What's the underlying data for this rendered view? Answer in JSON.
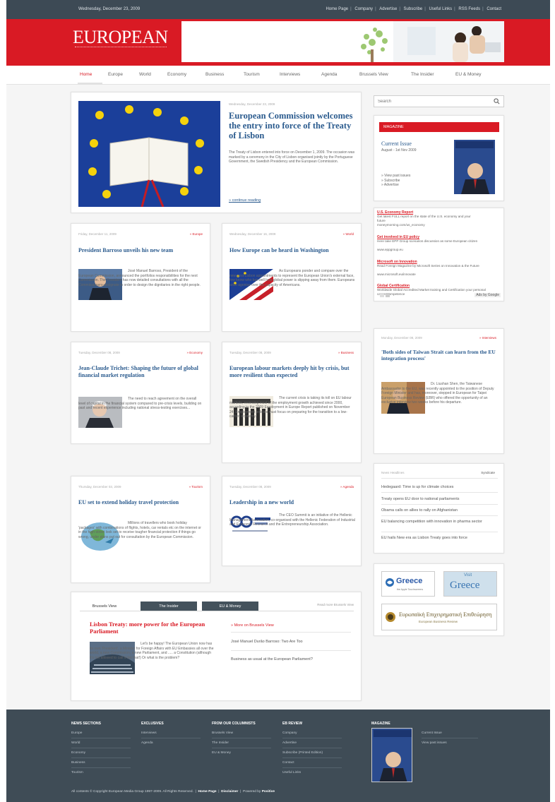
{
  "topbar": {
    "date": "Wednesday, December 23, 2009",
    "links": [
      "Home Page",
      "Company",
      "Advertise",
      "Subscribe",
      "Useful Links",
      "RSS Feeds",
      "Contact"
    ]
  },
  "brand": {
    "name": "EUROPEAN"
  },
  "nav": {
    "items": [
      "Home",
      "Europe",
      "World",
      "Economy",
      "Business",
      "Tourism",
      "Interviews",
      "Agenda",
      "Brussels View",
      "The Insider",
      "EU & Money"
    ]
  },
  "featured": {
    "date": "Wednesday, December 23, 2009",
    "title": "European Commission welcomes the entry into force of the Treaty of Lisbon",
    "summary": "The Treaty of Lisbon entered into force on December 1, 2009. The occasion was marked by a ceremony in the City of Lisbon organised jointly by the Portuguese Government, the Swedish Presidency and the European Commission.",
    "more": "continue reading"
  },
  "articles": [
    {
      "date": "Friday, December 11, 2009",
      "category": "Europe",
      "title": "President Barroso unveils his new team",
      "text": "José Manuel Barroso, President of the European Commission, announced the portfolios responsibilities for the next Commission. The President has now detailed consultations with all the Commissioners-designate in order to design the dignitaries in the right people."
    },
    {
      "date": "Wednesday, December 16, 2009",
      "category": "World",
      "title": "How Europe can be heard in Washington",
      "text": "As Europeans ponder and compare over the new post-Lisbon appointments to represent the European Union's external face, few know who but well how global power is slipping away from them. Europeans arise agonise over the capacity of Americans."
    },
    {
      "date": "Tuesday, December 08, 2009",
      "category": "Economy",
      "title": "Jean-Claude Trichet: Shaping the future of global financial market regulation",
      "text": "The need to reach agreement on the overall level of capital in the financial system compared to pre-crisis levels, building on past and recent experience including national stress-testing exercises..."
    },
    {
      "date": "Tuesday, December 08, 2009",
      "category": "Business",
      "title": "European labour markets deeply hit by crisis, but more resilient than expected",
      "text": "The current crisis is taking its toll on EU labour markets, reversing most of the employment growth achieved since 2000, according to the 2009 Employment in Europe Report published on November 24. Employment policies must focus on preparing for the transition to a low-carbon economy."
    },
    {
      "date": "Thursday, December 03, 2009",
      "category": "Tourism",
      "title": "EU set to extend holiday travel protection",
      "text": "Millions of travellers who book holiday 'packages' with combinations of flights, hotels, car rentals etc on the internet or in the high-street look set to receive tougher financial protection if things go wrong, under plans put out for consultation by the European Commission."
    },
    {
      "date": "Tuesday, December 08, 2009",
      "category": "Agenda",
      "title": "Leadership in a new world",
      "text": "The CEO Summit is an initiative of the Hellenic Management Association, co-organised with the Hellenic Federation of Industrial and Economic Research and the Entrepreneurship Association."
    }
  ],
  "search": {
    "placeholder": "Search"
  },
  "magazine": {
    "label": "MAGAZINE",
    "current_issue": "Current Issue",
    "issue_date": "August - 1st Nov 2009",
    "links": [
      "View past issues",
      "Subscribe",
      "Advertise"
    ]
  },
  "ads": {
    "items": [
      {
        "title": "U.S. Economy Report",
        "text": "Get latest FULL report on the state of the U.S. economy and your future",
        "url": "moneymorning.com/us_economy"
      },
      {
        "title": "Get involved in EU policy",
        "text": "Here take EPP Group scenarios discussion as some European citizen",
        "url": "www.eppgroup.eu"
      },
      {
        "title": "Microsoft on Innovation",
        "text": "Read Foreign Magazine by Microsoft Series on Innovation & the Future",
        "url": "www.microsoft.eu/innovate"
      },
      {
        "title": "Global Certification",
        "text": "Worldwide Global Accredited Market training and Certification your personal career competence",
        "url": ""
      }
    ],
    "provider": "Ads by Google"
  },
  "interview": {
    "date": "Monday, December 08, 2009",
    "category": "Interviews",
    "title": "'Both sides of Taiwan Strait can learn from the EU integration process'",
    "text": "Dr. Liushan Shen, the Taiwanese Ambassador to the EU, was recently appointed to the position of Deputy Foreign Minister and has, moreover, stepped in European for Taipei European Business Review (EBR) who offered the opportunity of an exclusive interview two weeks before his departure."
  },
  "headlines": {
    "title": "News Headlines",
    "link": "Syndicate",
    "items": [
      "Hedegaard: Time is up for climate choices",
      "Treaty opens EU door to national parliaments",
      "Obama calls on allies to rally on Afghanistan",
      "EU balancing competition with innovation in pharma sector",
      "EU hails New era as Lisbon Treaty goes into force"
    ]
  },
  "partners": {
    "greece1": "Greece",
    "greece1_sub": "the Apple Touchscreens",
    "greece2_top": "Visit",
    "greece2": "Greece",
    "lower_title": "Ευρωπαϊκή Επιχειρηματική Επιθεώρηση",
    "lower_sub": "European Business Review"
  },
  "bottom": {
    "tabs": [
      "Brussels View",
      "The Insider",
      "EU & Money"
    ],
    "link": "Read more Brussels View",
    "title": "Lisbon Treaty: more power for the European Parliament",
    "text": "Let's be happy! The European Union now has its own 'President', a Minister for Foreign Affairs with EU Embassies all over the world, a new Commission, a new Parliament, and ..... a Constitution (although it's not allowed to call it like that!) Or what is the problem?",
    "more_label": "More on Brussels View",
    "more_items": [
      "José Manuel Durão Barroso: Two Are Too",
      "Business as usual at the European Parliament?"
    ]
  },
  "footer": {
    "columns": [
      {
        "head": "NEWS SECTIONS",
        "items": [
          "Europe",
          "World",
          "Economy",
          "Business",
          "Tourism"
        ]
      },
      {
        "head": "EXCLUSIVES",
        "items": [
          "Interviews",
          "Agenda"
        ]
      },
      {
        "head": "FROM OUR COLUMNISTS",
        "items": [
          "Brussels View",
          "The Insider",
          "EU & Money"
        ]
      },
      {
        "head": "EB REVIEW",
        "items": [
          "Company",
          "Advertise",
          "Subscribe (Printed Edition)",
          "Contact",
          "Useful Links"
        ]
      }
    ],
    "magazine_head": "MAGAZINE",
    "magazine_links": [
      "Current Issue",
      "View past issues"
    ],
    "copyright": "All contents © Copyright European Media Group 1997-2009. All Rights Reserved.",
    "links": [
      "Home Page",
      "Disclaimer"
    ],
    "powered_prefix": "Powered by",
    "powered": "Positive"
  }
}
